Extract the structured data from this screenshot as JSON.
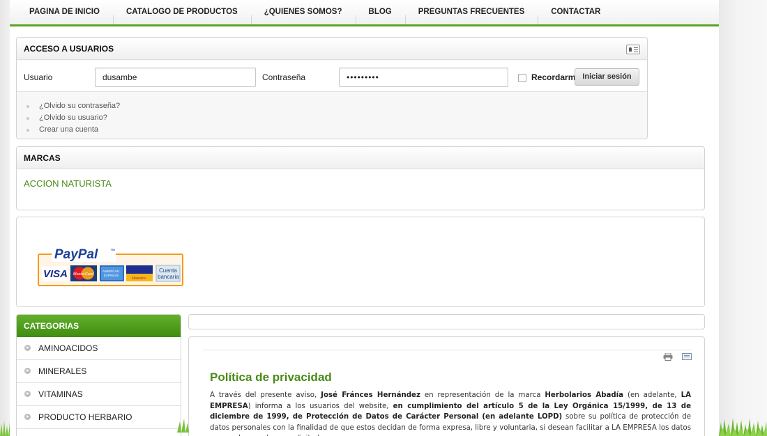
{
  "nav": {
    "items": [
      {
        "label": "PAGINA DE INICIO"
      },
      {
        "label": "CATALOGO DE PRODUCTOS"
      },
      {
        "label": "¿QUIENES SOMOS?"
      },
      {
        "label": "BLOG"
      },
      {
        "label": "PREGUNTAS FRECUENTES"
      },
      {
        "label": "CONTACTAR"
      }
    ]
  },
  "login": {
    "title": "ACCESO A USUARIOS",
    "user_label": "Usuario",
    "user_value": "dusambe",
    "password_label": "Contraseña",
    "password_value": "•••••••••",
    "remember_label": "Recordarme",
    "remember_checked": false,
    "submit_label": "Iniciar sesión",
    "links": [
      "¿Olvido su contraseña?",
      "¿Olvido su usuario?",
      "Crear una cuenta"
    ]
  },
  "marcas": {
    "title": "MARCAS",
    "items": [
      "ACCION NATURISTA"
    ]
  },
  "payments": {
    "brand": "PayPal",
    "methods": [
      "VISA",
      "MasterCard",
      "American Express",
      "Maestro",
      "Cuenta bancaria"
    ],
    "bank_label_1": "Cuenta",
    "bank_label_2": "bancaria"
  },
  "categorias": {
    "title": "CATEGORIAS",
    "items": [
      "AMINOACIDOS",
      "MINERALES",
      "VITAMINAS",
      "PRODUCTO HERBARIO",
      ""
    ]
  },
  "article": {
    "title": "Política de privacidad",
    "p1_a": "A través del presente aviso, ",
    "p1_b": "José Fránces Hernández",
    "p1_c": " en representación de la marca ",
    "p1_d": "Herbolarios Abadía",
    "p1_e": "  (en adelante, ",
    "p1_f": "LA EMPRESA",
    "p1_g": ") informa a los usuarios del website, ",
    "p1_h": "en cumplimiento del artículo 5 de la Ley Orgánica 15/1999, de 13 de diciembre de 1999, de Protección de Datos de Carácter Personal (en adelante LOPD)",
    "p1_i": " sobre su política de protección de datos personales con la finalidad de que estos decidan de forma expresa, libre y voluntaria, si desean facilitar a LA EMPRESA los datos personales que le son solicitados en"
  },
  "colors": {
    "accent_green": "#4a8a16",
    "nav_underline": "#5aa323",
    "category_header": "#4e9c1c"
  },
  "icons": [
    "vcard-icon",
    "print-icon",
    "email-icon",
    "category-bullet-icon",
    "checkbox"
  ]
}
